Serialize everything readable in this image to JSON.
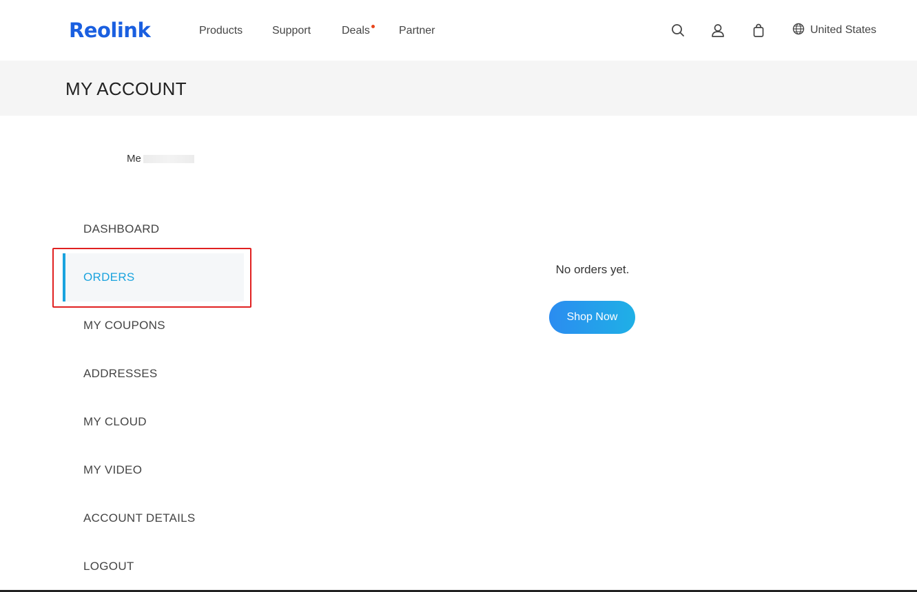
{
  "header": {
    "logo": "Reolink",
    "nav": [
      "Products",
      "Support",
      "Deals",
      "Partner"
    ],
    "icons": [
      "search-icon",
      "account-icon",
      "cart-icon",
      "globe-icon"
    ],
    "region": "United States"
  },
  "banner": {
    "title": "MY ACCOUNT"
  },
  "user": {
    "name_prefix": "Me"
  },
  "sidebar": {
    "items": [
      {
        "label": "DASHBOARD"
      },
      {
        "label": "ORDERS",
        "active": true
      },
      {
        "label": "MY COUPONS"
      },
      {
        "label": "ADDRESSES"
      },
      {
        "label": "MY CLOUD"
      },
      {
        "label": "MY VIDEO"
      },
      {
        "label": "ACCOUNT DETAILS"
      },
      {
        "label": "LOGOUT"
      }
    ]
  },
  "main": {
    "empty_message": "No orders yet.",
    "shop_button": "Shop Now"
  },
  "colors": {
    "brand": "#1a5fe0",
    "accent": "#1aa3de",
    "highlight": "#e02020",
    "deals_dot": "#e8451c"
  }
}
